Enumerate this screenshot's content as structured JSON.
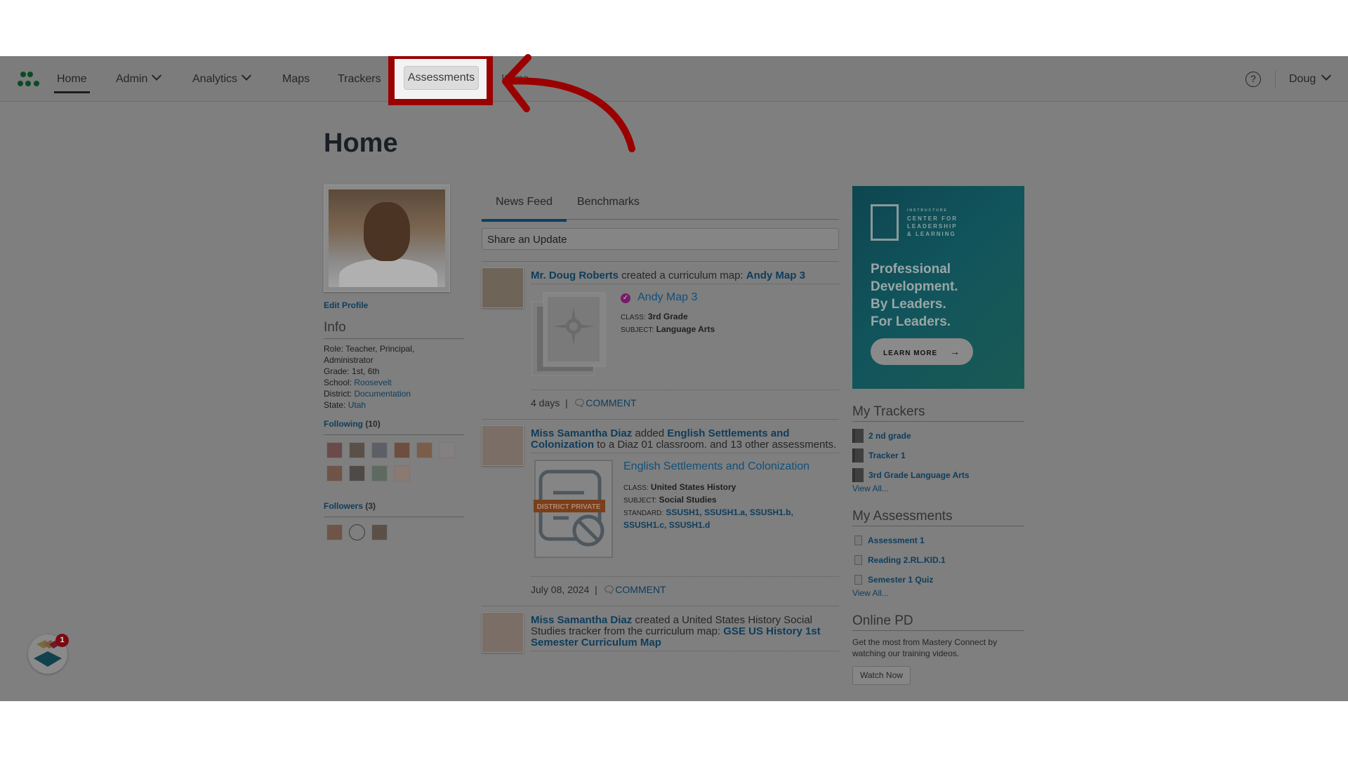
{
  "nav": {
    "items": [
      {
        "label": "Home",
        "active": true
      },
      {
        "label": "Admin",
        "dropdown": true
      },
      {
        "label": "Analytics",
        "dropdown": true
      },
      {
        "label": "Maps"
      },
      {
        "label": "Trackers"
      },
      {
        "label": "Assessments",
        "highlighted": true
      },
      {
        "label": "Items"
      }
    ],
    "help_icon": "question-circle-icon",
    "user": "Doug"
  },
  "page": {
    "title": "Home"
  },
  "profile": {
    "edit_label": "Edit Profile",
    "info_heading": "Info",
    "role_label": "Role:",
    "role": "Teacher, Principal, Administrator",
    "grade_label": "Grade:",
    "grade": "1st, 6th",
    "school_label": "School:",
    "school": "Roosevelt",
    "district_label": "District:",
    "district": "Documentation",
    "state_label": "State:",
    "state": "Utah",
    "following_label": "Following",
    "following_count": "(10)",
    "followers_label": "Followers",
    "followers_count": "(3)"
  },
  "feed": {
    "tabs": [
      "News Feed",
      "Benchmarks"
    ],
    "active_tab": "News Feed",
    "share_placeholder": "Share an Update",
    "items": [
      {
        "actor": "Mr. Doug Roberts",
        "action": " created a curriculum map: ",
        "object": "Andy Map 3",
        "rest": "",
        "card_title": "Andy Map 3",
        "class_label": "CLASS:",
        "class": "3rd Grade",
        "subject_label": "SUBJECT:",
        "subject": "Language Arts",
        "time": "4 days",
        "comment": "COMMENT"
      },
      {
        "actor": "Miss Samantha Diaz",
        "action": " added ",
        "object": "English Settlements and Colonization",
        "rest": " to a Diaz 01 classroom. and 13 other assessments.",
        "card_title": "English Settlements and Colonization",
        "badge": "DISTRICT PRIVATE",
        "class_label": "CLASS:",
        "class": "United States History",
        "subject_label": "SUBJECT:",
        "subject": "Social Studies",
        "standard_label": "STANDARD:",
        "standards": "SSUSH1, SSUSH1.a, SSUSH1.b, SSUSH1.c, SSUSH1.d",
        "time": "July 08, 2024",
        "comment": "COMMENT"
      },
      {
        "actor": "Miss Samantha Diaz",
        "action": " created a United States History Social Studies tracker from the curriculum map: ",
        "object": "GSE US History 1st Semester Curriculum Map",
        "rest": ""
      }
    ]
  },
  "sidebar": {
    "promo": {
      "brand_small": "INSTRUCTURE",
      "brand_line1": "CENTER FOR",
      "brand_line2": "LEADERSHIP",
      "brand_line3": "& LEARNING",
      "headline1": "Professional",
      "headline2": "Development.",
      "headline3": "By Leaders.",
      "headline4": "For Leaders.",
      "cta": "LEARN MORE"
    },
    "trackers_heading": "My Trackers",
    "trackers": [
      "2 nd grade",
      "Tracker 1",
      "3rd Grade Language Arts"
    ],
    "assessments_heading": "My Assessments",
    "assessments": [
      "Assessment 1",
      "Reading 2.RL.KID.1",
      "Semester 1 Quiz"
    ],
    "view_all": "View All...",
    "pd_heading": "Online PD",
    "pd_text": "Get the most from Mastery Connect by watching our training videos.",
    "pd_button": "Watch Now"
  },
  "widget": {
    "badge_count": "1"
  },
  "colors": {
    "annotation": "#9a0000",
    "link": "#0e3d5c",
    "tab_active": "#0d3f63"
  }
}
